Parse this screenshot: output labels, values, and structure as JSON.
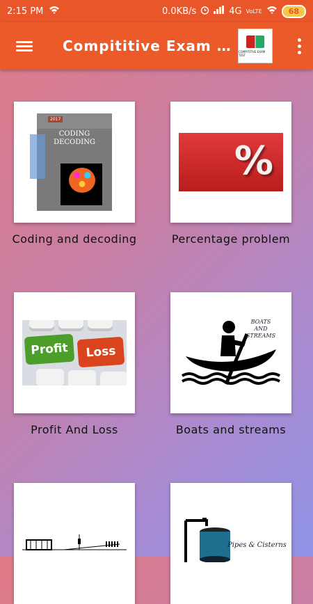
{
  "status_bar": {
    "time": "2:15 PM",
    "net_speed": "0.0KB/s",
    "network": "4G",
    "volte": "VoLTE",
    "battery": "68"
  },
  "app_bar": {
    "title": "Compititive Exam Te...",
    "logo_text": "COMPITITIVE EXAM TEST"
  },
  "topics": [
    {
      "label": "Coding and decoding",
      "art": {
        "year": "2017",
        "title1": "CODING",
        "title2": "DECODING"
      }
    },
    {
      "label": "Percentage problem",
      "art": {
        "symbol": "%"
      }
    },
    {
      "label": "Profit And Loss",
      "art": {
        "key1": "Profit",
        "key2": "Loss"
      }
    },
    {
      "label": "Boats and streams",
      "art": {
        "line1": "BOATS",
        "line2": "AND",
        "line3": "STREAMS"
      }
    },
    {
      "label": "",
      "art": {}
    },
    {
      "label": "",
      "art": {
        "caption": "Pipes & Cisterns"
      }
    }
  ],
  "colors": {
    "status_bar": "#e8562a",
    "app_bar": "#ec5a2a",
    "bg_top": "#e07a86",
    "bg_bottom": "#8f92e6"
  }
}
